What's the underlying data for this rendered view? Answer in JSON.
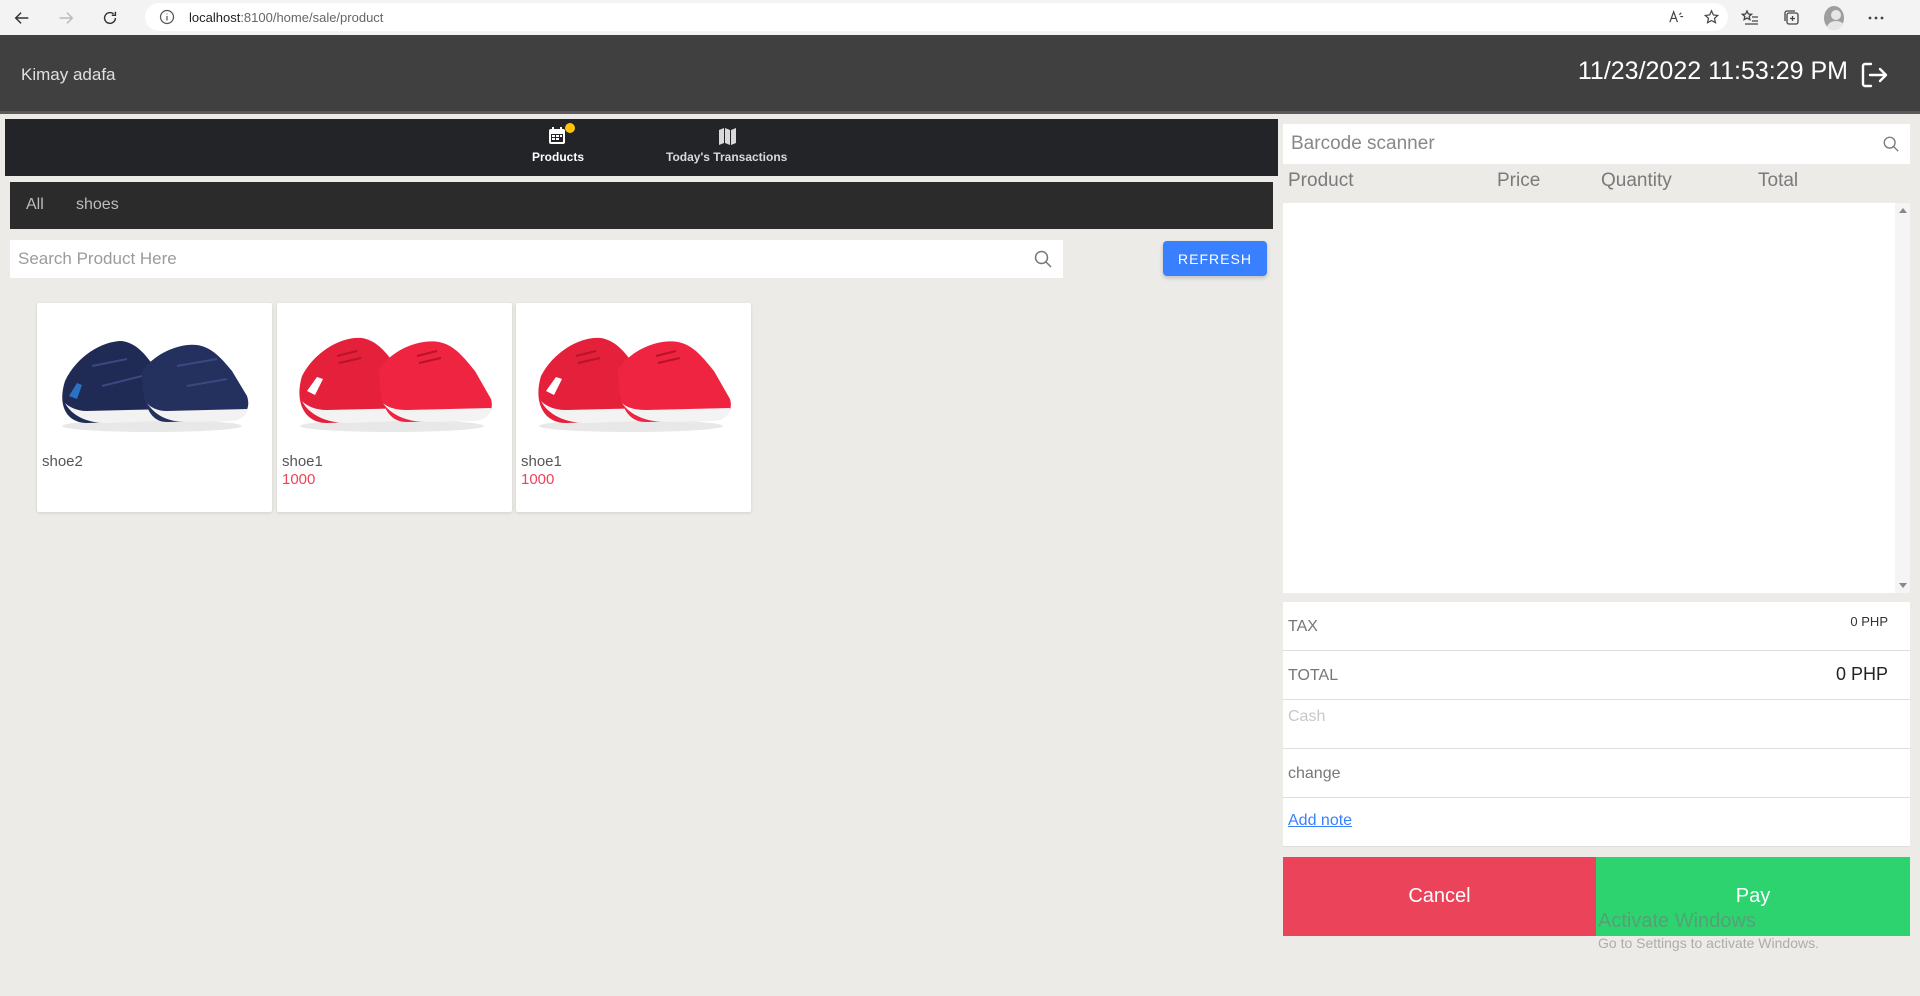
{
  "browser": {
    "url_host": "localhost",
    "url_rest": ":8100/home/sale/product"
  },
  "header": {
    "user_name": "Kimay adafa",
    "datetime": "11/23/2022 11:53:29 PM"
  },
  "tabs": [
    {
      "label": "Products",
      "icon": "calendar-icon",
      "badge": true
    },
    {
      "label": "Today's Transactions",
      "icon": "map-icon"
    }
  ],
  "categories": [
    "All",
    "shoes"
  ],
  "search": {
    "placeholder": "Search Product Here"
  },
  "refresh_label": "REFRESH",
  "products": [
    {
      "name": "shoe2",
      "price": "",
      "color": "navy"
    },
    {
      "name": "shoe1",
      "price": "1000",
      "color": "red"
    },
    {
      "name": "shoe1",
      "price": "1000",
      "color": "red"
    }
  ],
  "cart": {
    "barcode_placeholder": "Barcode scanner",
    "columns": [
      "Product",
      "Price",
      "Quantity",
      "Total"
    ]
  },
  "summary": {
    "tax_label": "TAX",
    "tax_value": "0 PHP",
    "total_label": "TOTAL",
    "total_value": "0 PHP",
    "cash_placeholder": "Cash",
    "change_label": "change",
    "add_note": "Add note"
  },
  "actions": {
    "cancel": "Cancel",
    "pay": "Pay"
  },
  "watermark": {
    "title": "Activate Windows",
    "subtitle": "Go to Settings to activate Windows."
  },
  "colors": {
    "danger": "#eb445a",
    "success": "#2dd36f",
    "primary": "#3880ff",
    "header": "#404040"
  }
}
